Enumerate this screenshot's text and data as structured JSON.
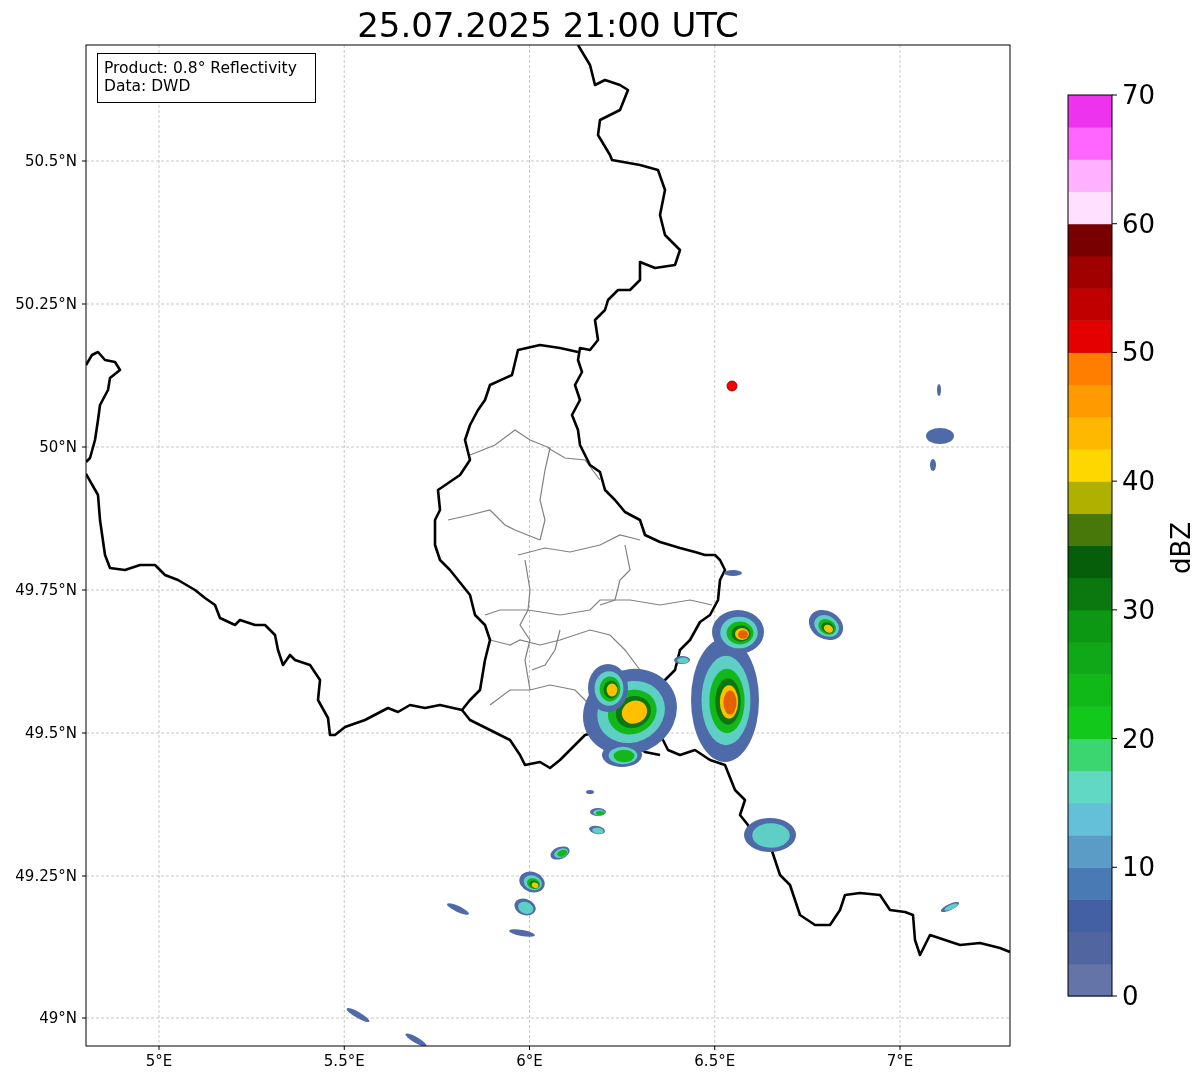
{
  "title": "25.07.2025 21:00 UTC",
  "legend": [
    "Product: 0.8° Reflectivity",
    "Data: DWD"
  ],
  "map": {
    "lat_ticks": [
      "50.5°N",
      "50.25°N",
      "50°N",
      "49.75°N",
      "49.5°N",
      "49.25°N",
      "49°N"
    ],
    "lon_ticks": [
      "5°E",
      "5.5°E",
      "6°E",
      "6.5°E",
      "7°E"
    ]
  },
  "colorbar": {
    "label": "dBZ",
    "ticks": [
      "70",
      "60",
      "50",
      "40",
      "30",
      "20",
      "10",
      "0"
    ],
    "segments": [
      {
        "color": "#6474a8"
      },
      {
        "color": "#5166a0"
      },
      {
        "color": "#4360a4"
      },
      {
        "color": "#4a7ab4"
      },
      {
        "color": "#5b9cc6"
      },
      {
        "color": "#63c0d8"
      },
      {
        "color": "#60d8c4"
      },
      {
        "color": "#3cd670"
      },
      {
        "color": "#12c81a"
      },
      {
        "color": "#10b818"
      },
      {
        "color": "#10a818"
      },
      {
        "color": "#0c9812"
      },
      {
        "color": "#0a780e"
      },
      {
        "color": "#065e0a"
      },
      {
        "color": "#48780a"
      },
      {
        "color": "#b0b000"
      },
      {
        "color": "#ffd700"
      },
      {
        "color": "#ffb800"
      },
      {
        "color": "#ff9a00"
      },
      {
        "color": "#ff7e00"
      },
      {
        "color": "#e40000"
      },
      {
        "color": "#c00000"
      },
      {
        "color": "#a00000"
      },
      {
        "color": "#780000"
      },
      {
        "color": "#ffe0ff"
      },
      {
        "color": "#ffb0ff"
      },
      {
        "color": "#ff66ff"
      },
      {
        "color": "#ee33ee"
      }
    ]
  }
}
